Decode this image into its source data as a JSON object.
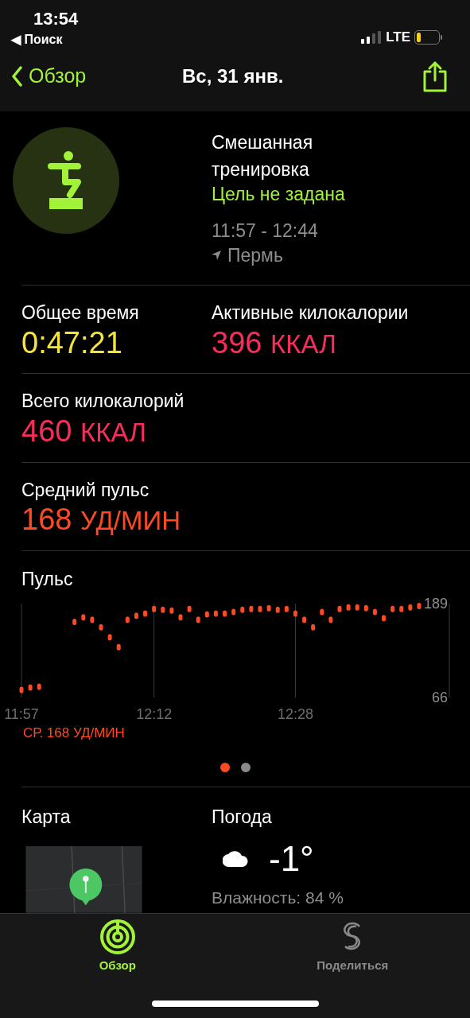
{
  "status_bar": {
    "time": "13:54",
    "back_app": "◀ Поиск",
    "network": "LTE"
  },
  "nav": {
    "back": "Обзор",
    "title": "Вс, 31 янв."
  },
  "workout": {
    "name": "Смешанная тренировка",
    "goal": "Цель не задана",
    "time_range": "11:57 - 12:44",
    "location": "Пермь"
  },
  "stat_rows": [
    [
      {
        "label": "Общее время",
        "value": "0:47:21",
        "color": "#f5e43a"
      },
      {
        "label": "Активные килокалории",
        "value": "396",
        "unit": "ККАЛ",
        "color": "#fa2d5a"
      }
    ],
    [
      {
        "label": "Всего килокалорий",
        "value": "460",
        "unit": "ККАЛ",
        "color": "#fa2d5a"
      }
    ],
    [
      {
        "label": "Средний пульс",
        "value": "168",
        "unit": "УД/МИН",
        "color": "#fd4a22"
      }
    ]
  ],
  "heart_rate": {
    "title": "Пульс",
    "average": "СР. 168 УД/МИН",
    "chart_data": {
      "type": "scatter",
      "categories": [
        "11:57",
        null,
        null,
        null,
        null,
        null,
        null,
        null,
        null,
        null,
        null,
        null,
        null,
        null,
        null,
        "12:12",
        null,
        null,
        null,
        null,
        null,
        null,
        null,
        null,
        null,
        null,
        null,
        null,
        null,
        null,
        null,
        "12:28",
        null,
        null,
        null,
        null,
        null,
        null,
        null,
        null,
        null,
        null,
        null,
        null,
        null,
        null
      ],
      "ylim": [
        66,
        189
      ],
      "yticks": [
        66,
        189
      ],
      "grid": true,
      "series": [
        {
          "color": "#fd4a22",
          "values": [
            76,
            79,
            80,
            null,
            null,
            null,
            165,
            171,
            168,
            158,
            145,
            132,
            168,
            173,
            176,
            182,
            181,
            180,
            171,
            182,
            168,
            175,
            176,
            176,
            178,
            181,
            182,
            182,
            183,
            181,
            182,
            176,
            168,
            158,
            178,
            168,
            182,
            184,
            184,
            183,
            178,
            170,
            182,
            182,
            184,
            186
          ]
        }
      ]
    }
  },
  "pages": [
    {
      "selected": true
    },
    {
      "selected": false
    }
  ],
  "map": {
    "title": "Карта",
    "kind": "picture"
  },
  "weather": {
    "title": "Погода",
    "temperature": "-1°",
    "humidity": "Влажность: 84 %"
  },
  "tabs": [
    {
      "label": "Обзор",
      "selected": true
    },
    {
      "label": "Поделиться",
      "selected": false
    }
  ]
}
